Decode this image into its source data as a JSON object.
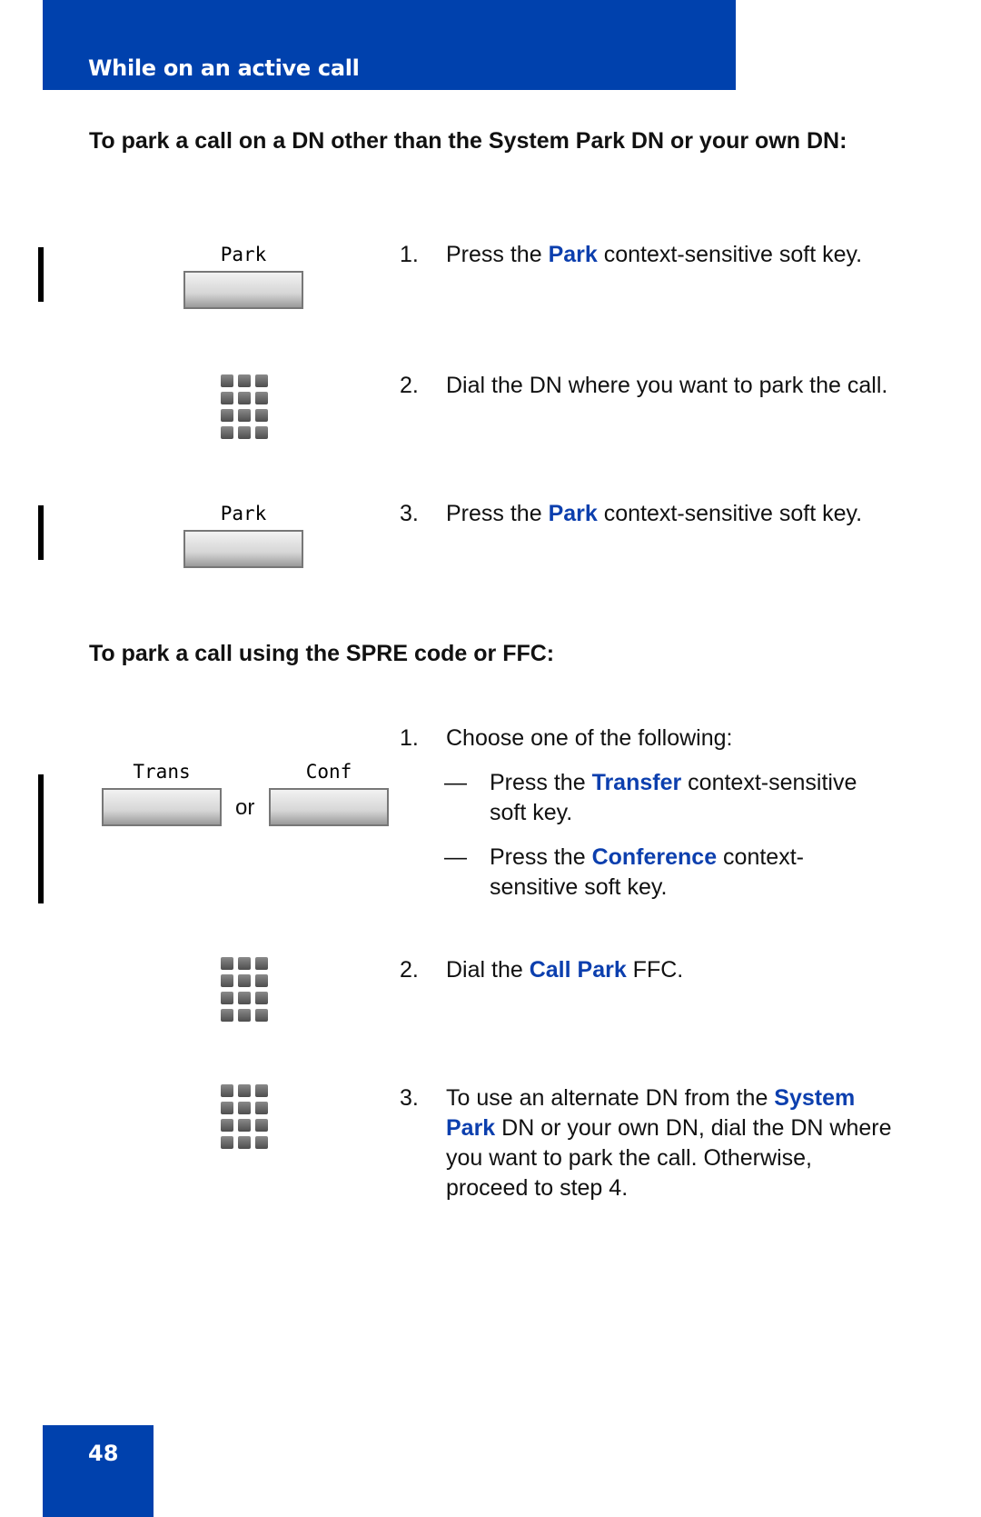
{
  "header": {
    "title": "While on an active call"
  },
  "section1": {
    "title": "To park a call on a DN other than the System Park DN or your own DN:",
    "softkey_label": "Park",
    "steps": [
      {
        "num": "1.",
        "pre": "Press the ",
        "highlight": "Park",
        "post": " context-sensitive soft key."
      },
      {
        "num": "2.",
        "text": "Dial the DN where you want to park the call."
      },
      {
        "num": "3.",
        "pre": "Press the ",
        "highlight": "Park",
        "post": " context-sensitive soft key."
      }
    ]
  },
  "section2": {
    "title": "To park a call using the SPRE code or FFC:",
    "softkeys": {
      "trans": "Trans",
      "conf": "Conf",
      "or": "or"
    },
    "steps": [
      {
        "num": "1.",
        "text": "Choose one of the following:"
      },
      {
        "num": "2.",
        "pre": "Dial the ",
        "highlight": "Call Park",
        "post": " FFC."
      },
      {
        "num": "3.",
        "pre": "To use an alternate DN from the ",
        "highlight": "System Park",
        "post": " DN or your own DN, dial the DN where you want to park the call. Otherwise, proceed to step 4."
      }
    ],
    "options": [
      {
        "dash": "—",
        "pre": "Press the ",
        "highlight": "Transfer",
        "post": " context-sensitive soft key."
      },
      {
        "dash": "—",
        "pre": "Press the ",
        "highlight": "Conference",
        "post": " context-sensitive soft key."
      }
    ]
  },
  "footer": {
    "page_number": "48"
  },
  "colors": {
    "brand_blue": "#0041ad",
    "highlight_blue": "#0c3fae"
  }
}
